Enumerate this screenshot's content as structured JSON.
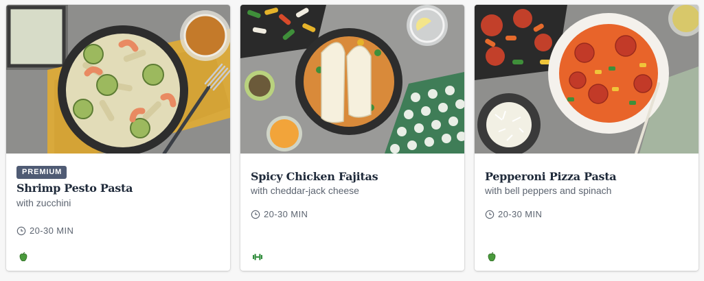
{
  "recipes": [
    {
      "badge": "PREMIUM",
      "title": "Shrimp Pesto Pasta",
      "subtitle": "with zucchini",
      "time": "20-30 MIN",
      "tag_icon": "apple-icon",
      "photo_icon": "shrimp-pesto-pasta-photo"
    },
    {
      "title": "Spicy Chicken Fajitas",
      "subtitle": "with cheddar-jack cheese",
      "time": "20-30 MIN",
      "tag_icon": "dumbbell-icon",
      "photo_icon": "chicken-fajitas-photo"
    },
    {
      "title": "Pepperoni Pizza Pasta",
      "subtitle": "with bell peppers and spinach",
      "time": "20-30 MIN",
      "tag_icon": "apple-icon",
      "photo_icon": "pepperoni-pizza-pasta-photo"
    }
  ],
  "colors": {
    "badge_bg": "#4f5b74",
    "title_text": "#1f2a3a",
    "muted_text": "#5c6470",
    "tag_green": "#2e8b3a"
  }
}
